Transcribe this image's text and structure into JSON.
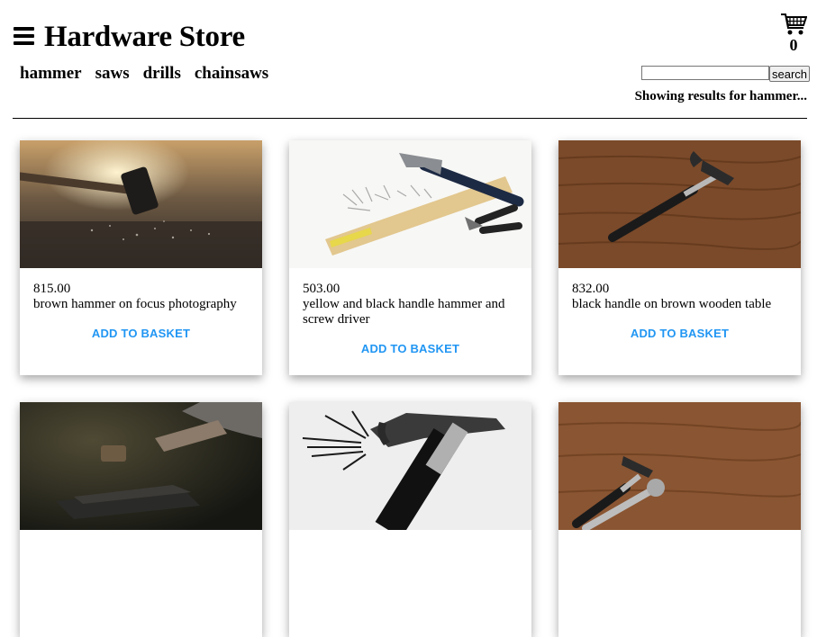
{
  "header": {
    "title": "Hardware Store",
    "cart_count": "0",
    "menu_icon": "hamburger-menu-icon",
    "cart_icon": "shopping-cart-icon"
  },
  "nav": {
    "items": [
      {
        "label": "hammer"
      },
      {
        "label": "saws"
      },
      {
        "label": "drills"
      },
      {
        "label": "chainsaws"
      }
    ]
  },
  "search": {
    "value": "",
    "button_label": "search"
  },
  "results_text": "Showing results for hammer...",
  "products": [
    {
      "price": "815.00",
      "description": "brown hammer on focus photography",
      "action": "ADD TO BASKET"
    },
    {
      "price": "503.00",
      "description": "yellow and black handle hammer and screw driver",
      "action": "ADD TO BASKET"
    },
    {
      "price": "832.00",
      "description": "black handle on brown wooden table",
      "action": "ADD TO BASKET"
    },
    {
      "price": "",
      "description": "",
      "action": ""
    },
    {
      "price": "",
      "description": "",
      "action": ""
    },
    {
      "price": "",
      "description": "",
      "action": ""
    }
  ],
  "colors": {
    "accent": "#2196F3",
    "text": "#000000",
    "background": "#ffffff"
  }
}
